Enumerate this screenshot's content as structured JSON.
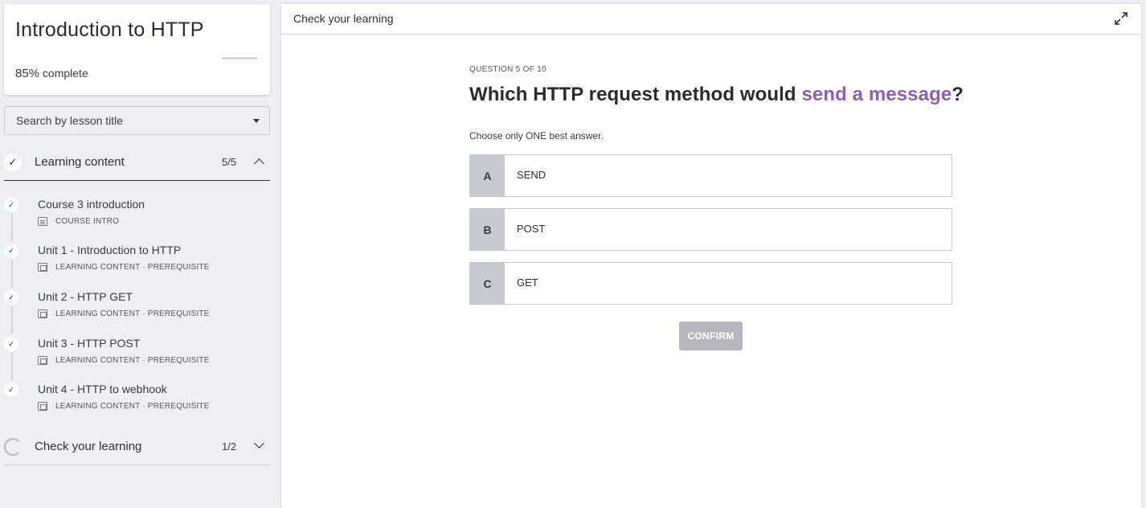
{
  "course": {
    "title": "Introduction to HTTP",
    "progress_percent": "85%",
    "progress_label": "complete",
    "progress_fraction": 0.85
  },
  "search": {
    "placeholder": "Search by lesson title"
  },
  "sections": [
    {
      "title": "Learning content",
      "count": "5/5",
      "expanded": true,
      "lessons": [
        {
          "title": "Course 3 introduction",
          "meta": "COURSE INTRO",
          "icon": "document-icon"
        },
        {
          "title": "Unit 1 - Introduction to HTTP",
          "meta": "LEARNING CONTENT · PREREQUISITE",
          "icon": "screen-icon"
        },
        {
          "title": "Unit 2 - HTTP GET",
          "meta": "LEARNING CONTENT · PREREQUISITE",
          "icon": "screen-icon"
        },
        {
          "title": "Unit 3 - HTTP POST",
          "meta": "LEARNING CONTENT · PREREQUISITE",
          "icon": "screen-icon"
        },
        {
          "title": "Unit 4 - HTTP to webhook",
          "meta": "LEARNING CONTENT · PREREQUISITE",
          "icon": "screen-icon"
        }
      ]
    },
    {
      "title": "Check your learning",
      "count": "1/2",
      "expanded": false
    }
  ],
  "main": {
    "header_title": "Check your learning",
    "question_counter": "QUESTION 5 OF 10",
    "question_prefix": "Which HTTP request method would ",
    "question_highlight": "send a message",
    "question_suffix": "?",
    "instruction": "Choose only ONE best answer.",
    "options": [
      {
        "letter": "A",
        "text": "SEND"
      },
      {
        "letter": "B",
        "text": "POST"
      },
      {
        "letter": "C",
        "text": "GET"
      }
    ],
    "confirm_label": "CONFIRM"
  },
  "colors": {
    "accent": "#8e5fb5",
    "option_letter_bg": "#c8c9d2",
    "confirm_disabled": "#b7b8bd"
  }
}
